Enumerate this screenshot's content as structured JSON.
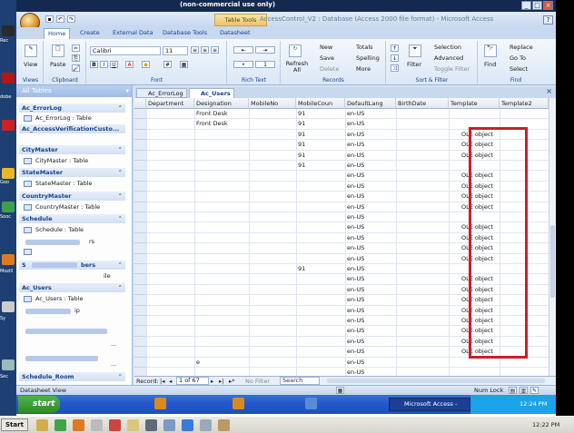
{
  "window": {
    "title": "(non-commercial use only)",
    "app_title": "AccessControl_V2 : Database (Access 2000 file format) - Microsoft Access",
    "table_tools": "Table Tools"
  },
  "ribbon_tabs": [
    "Home",
    "Create",
    "External Data",
    "Database Tools",
    "Datasheet"
  ],
  "ribbon": {
    "views": {
      "view_label": "View",
      "group": "Views"
    },
    "clipboard": {
      "paste_label": "Paste",
      "group": "Clipboard"
    },
    "font": {
      "family": "Calibri",
      "size": "11",
      "group": "Font"
    },
    "rich_text": {
      "group": "Rich Text"
    },
    "records": {
      "refresh_label": "Refresh All",
      "new": "New",
      "save": "Save",
      "delete": "Delete",
      "totals": "Totals",
      "spelling": "Spelling",
      "more": "More",
      "group": "Records"
    },
    "sort_filter": {
      "filter_label": "Filter",
      "selection": "Selection",
      "advanced": "Advanced",
      "toggle_filter": "Toggle Filter",
      "group": "Sort & Filter"
    },
    "find": {
      "find_label": "Find",
      "replace": "Replace",
      "goto": "Go To",
      "select": "Select",
      "group": "Find"
    }
  },
  "nav": {
    "header": "All Tables",
    "groups": [
      {
        "title": "Ac_ErrorLog",
        "items": [
          "Ac_ErrorLog : Table"
        ]
      },
      {
        "title": "Ac_AccessVerificationCusto...",
        "items": [
          ""
        ]
      },
      {
        "title": "CityMaster",
        "items": [
          "CityMaster : Table"
        ]
      },
      {
        "title": "StateMaster",
        "items": [
          "StateMaster : Table"
        ]
      },
      {
        "title": "CountryMaster",
        "items": [
          "CountryMaster : Table"
        ]
      },
      {
        "title": "Schedule",
        "items": [
          "Schedule : Table"
        ]
      },
      {
        "title": "",
        "items": [
          "rs"
        ]
      },
      {
        "title": "S",
        "items": [
          "bers",
          "ile"
        ]
      },
      {
        "title": "Ac_Users",
        "items": [
          "Ac_Users : Table"
        ]
      },
      {
        "title": "",
        "items": [
          "ip"
        ]
      },
      {
        "title": "",
        "items": [
          "",
          "..."
        ]
      },
      {
        "title": "",
        "items": [
          "",
          "..."
        ]
      },
      {
        "title": "Schedule_Room",
        "items": [
          ""
        ]
      }
    ]
  },
  "doc_tabs": [
    "Ac_ErrorLog",
    "Ac_Users"
  ],
  "grid": {
    "columns": [
      "Department",
      "Designation",
      "MobileNo",
      "MobileCoun",
      "DefaultLang",
      "BirthDate",
      "Template",
      "Template2"
    ],
    "rows": [
      {
        "designation": "Front Desk",
        "mobilecoun": "91",
        "lang": "en-US",
        "template": ""
      },
      {
        "designation": "Front Desk",
        "mobilecoun": "91",
        "lang": "en-US",
        "template": ""
      },
      {
        "designation": "",
        "mobilecoun": "91",
        "lang": "en-US",
        "template": "OLE object"
      },
      {
        "designation": "",
        "mobilecoun": "91",
        "lang": "en-US",
        "template": "OLE object"
      },
      {
        "designation": "",
        "mobilecoun": "91",
        "lang": "en-US",
        "template": "OLE object"
      },
      {
        "designation": "",
        "mobilecoun": "91",
        "lang": "en-US",
        "template": ""
      },
      {
        "designation": "",
        "mobilecoun": "",
        "lang": "en-US",
        "template": "OLE object"
      },
      {
        "designation": "",
        "mobilecoun": "",
        "lang": "en-US",
        "template": "OLE object"
      },
      {
        "designation": "",
        "mobilecoun": "",
        "lang": "en-US",
        "template": "OLE object"
      },
      {
        "designation": "",
        "mobilecoun": "",
        "lang": "en-US",
        "template": "OLE object"
      },
      {
        "designation": "",
        "mobilecoun": "",
        "lang": "en-US",
        "template": ""
      },
      {
        "designation": "",
        "mobilecoun": "",
        "lang": "en-US",
        "template": "OLE object"
      },
      {
        "designation": "",
        "mobilecoun": "",
        "lang": "en-US",
        "template": "OLE object"
      },
      {
        "designation": "",
        "mobilecoun": "",
        "lang": "en-US",
        "template": "OLE object"
      },
      {
        "designation": "",
        "mobilecoun": "",
        "lang": "en-US",
        "template": "OLE object"
      },
      {
        "designation": "",
        "mobilecoun": "91",
        "lang": "en-US",
        "template": ""
      },
      {
        "designation": "",
        "mobilecoun": "",
        "lang": "en-US",
        "template": "OLE object"
      },
      {
        "designation": "",
        "mobilecoun": "",
        "lang": "en-US",
        "template": "OLE object"
      },
      {
        "designation": "",
        "mobilecoun": "",
        "lang": "en-US",
        "template": "OLE object"
      },
      {
        "designation": "",
        "mobilecoun": "",
        "lang": "en-US",
        "template": "OLE object"
      },
      {
        "designation": "",
        "mobilecoun": "",
        "lang": "en-US",
        "template": "OLE object"
      },
      {
        "designation": "",
        "mobilecoun": "",
        "lang": "en-US",
        "template": "OLE object"
      },
      {
        "designation": "",
        "mobilecoun": "",
        "lang": "en-US",
        "template": "OLE object"
      },
      {
        "designation": "",
        "mobilecoun": "",
        "lang": "en-US",
        "template": "OLE object"
      },
      {
        "designation": "e",
        "mobilecoun": "",
        "lang": "en-US",
        "template": ""
      },
      {
        "designation": "",
        "mobilecoun": "",
        "lang": "en-US",
        "template": ""
      }
    ]
  },
  "record_nav": {
    "label": "Record:",
    "position": "1 of 67",
    "no_filter": "No Filter",
    "search": "Search"
  },
  "status": {
    "left": "Datasheet View",
    "numlock": "Num Lock"
  },
  "taskbar": {
    "start": "start",
    "task": "Microsoft Access -",
    "clock": "12:24 PM"
  },
  "outer_taskbar": {
    "start": "Start",
    "clock": "12:22 PM"
  },
  "desktop_labels": [
    "Rec",
    "dobe",
    "Goo",
    "Sooc",
    "Mozill",
    "Sy",
    "Sec"
  ],
  "colors": {
    "highlight_frame": "#c8202a",
    "ribbon_blue": "#15428b",
    "title_bar": "#13294f"
  }
}
